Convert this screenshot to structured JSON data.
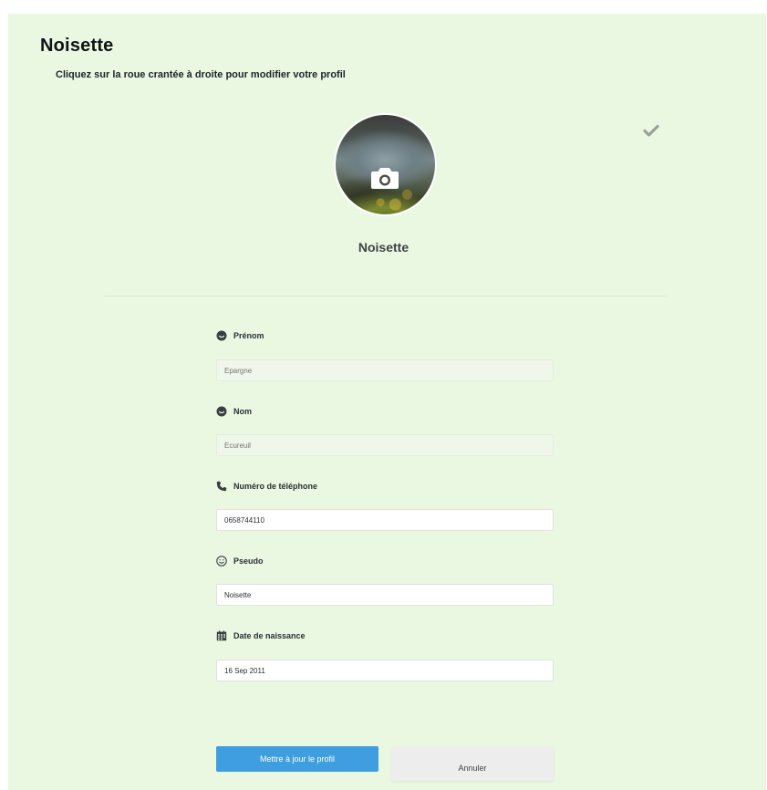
{
  "header": {
    "title": "Noisette",
    "subtitle": "Cliquez sur la roue crantée à droite pour modifier votre profil"
  },
  "profile": {
    "display_name": "Noisette",
    "avatar_icon": "camera-icon",
    "confirm_icon": "checkmark-icon"
  },
  "form": {
    "first_name": {
      "label": "Prénom",
      "placeholder": "Epargne",
      "icon": "user-face-icon"
    },
    "last_name": {
      "label": "Nom",
      "placeholder": "Ecureuil",
      "icon": "user-face-icon"
    },
    "phone": {
      "label": "Numéro de téléphone",
      "value": "0658744110",
      "icon": "phone-icon"
    },
    "nickname": {
      "label": "Pseudo",
      "value": "Noisette",
      "icon": "smiley-icon"
    },
    "birthdate": {
      "label": "Date de naissance",
      "value": "16 Sep 2011",
      "icon": "calendar-icon"
    }
  },
  "actions": {
    "update_label": "Mettre à jour le profil",
    "cancel_label": "Annuler"
  },
  "colors": {
    "panel_bg": "#eaf8e2",
    "primary": "#3f9ee0",
    "secondary_btn": "#ededed"
  }
}
